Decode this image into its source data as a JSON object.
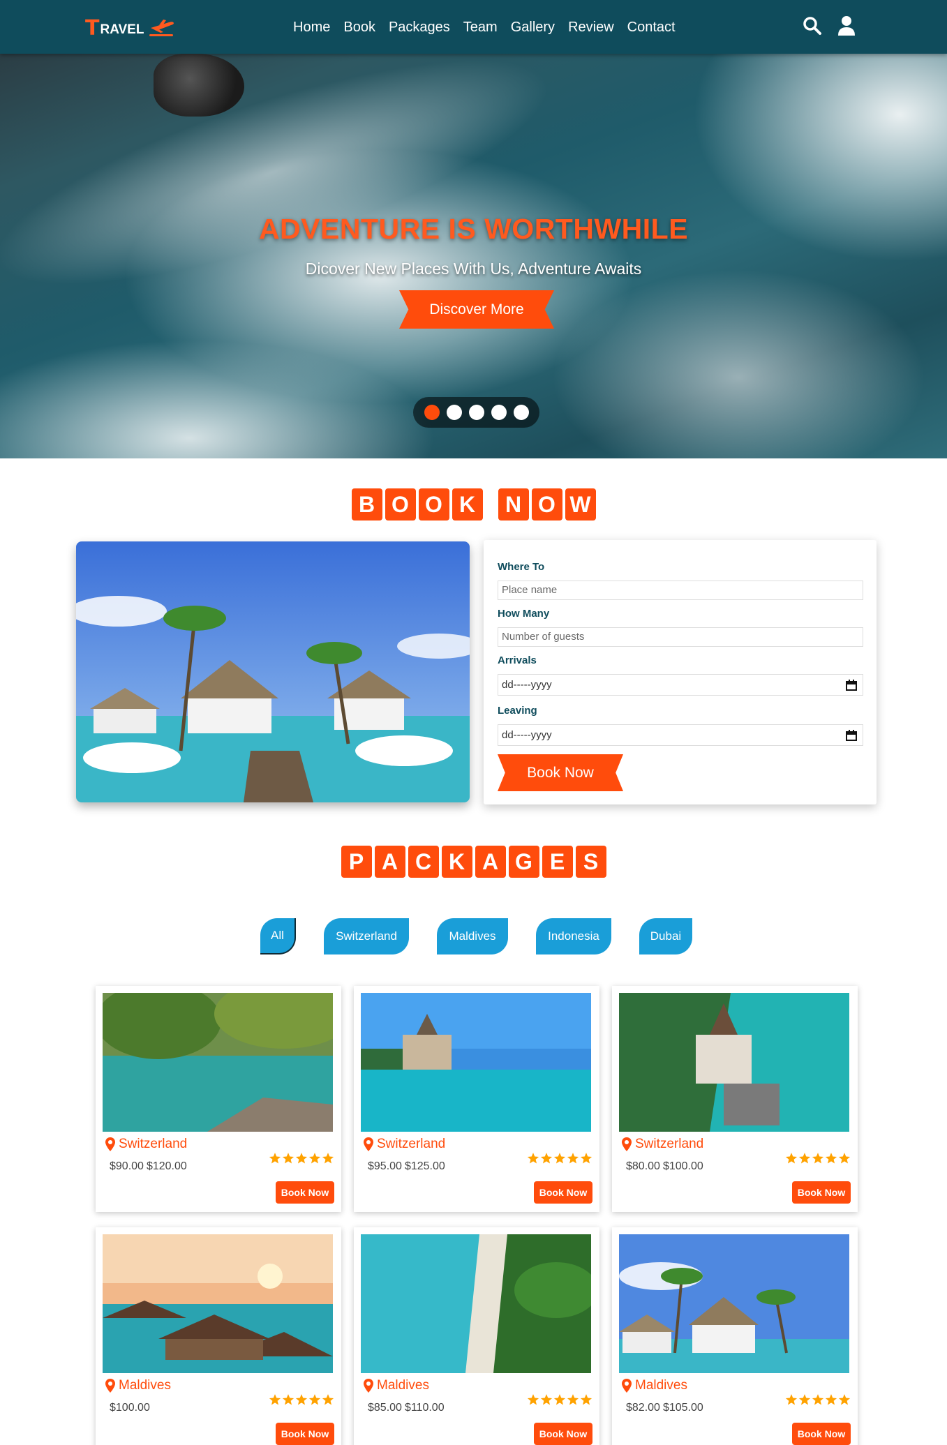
{
  "brand": {
    "logo_initial": "T",
    "logo_rest": "RAVEL",
    "accent": "#ff4c0c",
    "nav_bg": "#0f4c5c"
  },
  "nav": {
    "links": [
      "Home",
      "Book",
      "Packages",
      "Team",
      "Gallery",
      "Review",
      "Contact"
    ],
    "icons": [
      "search-icon",
      "user-icon"
    ]
  },
  "hero": {
    "title": "ADVENTURE IS WORTHWHILE",
    "subtitle": "Dicover New Places With Us, Adventure Awaits",
    "button": "Discover More",
    "slides": 5,
    "active_slide": 1
  },
  "book": {
    "heading_words": [
      "BOOK",
      "NOW"
    ],
    "form": {
      "where_label": "Where To",
      "where_placeholder": "Place name",
      "how_many_label": "How Many",
      "how_many_placeholder": "Number of guests",
      "arrivals_label": "Arrivals",
      "arrivals_value": "dd-----yyyy",
      "leaving_label": "Leaving",
      "leaving_value": "dd-----yyyy",
      "submit": "Book Now"
    }
  },
  "packages": {
    "heading_words": [
      "PACKAGES"
    ],
    "filters": [
      "All",
      "Switzerland",
      "Maldives",
      "Indonesia",
      "Dubai"
    ],
    "active_filter": "All",
    "cards": [
      {
        "place": "Switzerland",
        "price": "$90.00",
        "old_price": "$120.00",
        "rating": 5,
        "button": "Book Now"
      },
      {
        "place": "Switzerland",
        "price": "$95.00",
        "old_price": "$125.00",
        "rating": 5,
        "button": "Book Now"
      },
      {
        "place": "Switzerland",
        "price": "$80.00",
        "old_price": "$100.00",
        "rating": 5,
        "button": "Book Now"
      },
      {
        "place": "Maldives",
        "price": "$100.00",
        "old_price": "",
        "rating": 5,
        "button": "Book Now"
      },
      {
        "place": "Maldives",
        "price": "$85.00",
        "old_price": "$110.00",
        "rating": 5,
        "button": "Book Now"
      },
      {
        "place": "Maldives",
        "price": "$82.00",
        "old_price": "$105.00",
        "rating": 5,
        "button": "Book Now"
      }
    ]
  }
}
